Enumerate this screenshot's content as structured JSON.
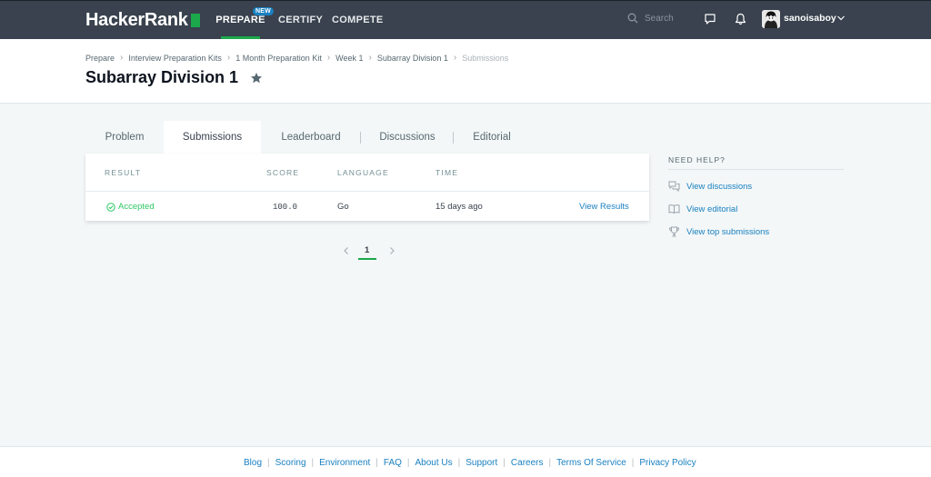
{
  "topnav": {
    "logo": "HackerRank",
    "items": [
      {
        "label": "PREPARE"
      },
      {
        "label": "CERTIFY"
      },
      {
        "label": "COMPETE"
      }
    ],
    "new_badge": "NEW",
    "search_placeholder": "Search",
    "username": "sanoisaboy"
  },
  "breadcrumb": [
    "Prepare",
    "Interview Preparation Kits",
    "1 Month Preparation Kit",
    "Week 1",
    "Subarray Division 1",
    "Submissions"
  ],
  "page_title": "Subarray Division 1",
  "tabs": [
    "Problem",
    "Submissions",
    "Leaderboard",
    "Discussions",
    "Editorial"
  ],
  "table": {
    "headers": [
      "RESULT",
      "SCORE",
      "LANGUAGE",
      "TIME"
    ],
    "rows": [
      {
        "result": "Accepted",
        "score": "100.0",
        "language": "Go",
        "time": "15 days ago",
        "action": "View Results"
      }
    ]
  },
  "pagination": {
    "current": "1"
  },
  "help": {
    "title": "NEED HELP?",
    "items": [
      "View discussions",
      "View editorial",
      "View top submissions"
    ]
  },
  "footer": {
    "links": [
      "Blog",
      "Scoring",
      "Environment",
      "FAQ",
      "About Us",
      "Support",
      "Careers",
      "Terms Of Service",
      "Privacy Policy"
    ]
  },
  "colors": {
    "nav_bg": "#39424e",
    "accent_green": "#1ba94c",
    "link_blue": "#1a80c1",
    "accepted_green": "#2ec866",
    "page_bg": "#f3f7f7"
  }
}
